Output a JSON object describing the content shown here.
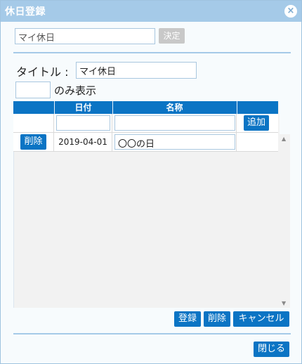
{
  "dialog": {
    "title": "休日登録",
    "close_label": "×"
  },
  "selector": {
    "value": "マイ休日",
    "decide_label": "決定"
  },
  "form": {
    "title_label": "タイトル :",
    "title_value": "マイ休日",
    "only_show_label": "のみ表示",
    "only_show_value": ""
  },
  "table": {
    "headers": [
      "日付",
      "名称"
    ],
    "new_row": {
      "date": "",
      "name": "",
      "add_label": "追加"
    },
    "rows": [
      {
        "delete_label": "削除",
        "date": "2019-04-01",
        "name": "〇〇の日"
      }
    ]
  },
  "actions": {
    "register_label": "登録",
    "delete_label": "削除",
    "cancel_label": "キャンセル",
    "close_label": "閉じる"
  },
  "colors": {
    "accent": "#0b74c4",
    "titlebar": "#a5cae8"
  }
}
